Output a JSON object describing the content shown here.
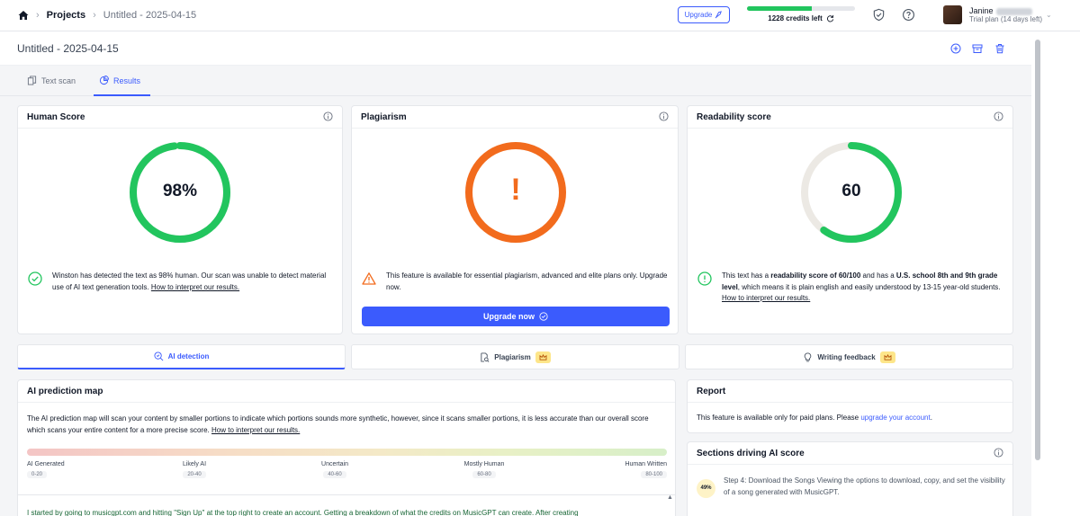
{
  "breadcrumb": {
    "projects": "Projects",
    "document": "Untitled - 2025-04-15"
  },
  "topbar": {
    "upgrade_label": "Upgrade",
    "credits_label": "1228 credits left",
    "credits_fraction": 0.6
  },
  "user": {
    "name": "Janine",
    "plan": "Trial plan (14 days left)"
  },
  "document": {
    "title": "Untitled - 2025-04-15"
  },
  "tabs": [
    {
      "label": "Text scan",
      "active": false
    },
    {
      "label": "Results",
      "active": true
    }
  ],
  "human_score": {
    "title": "Human Score",
    "value": "98%",
    "percent": 98,
    "note_pre": "Winston has detected the text as 98% human. Our scan was unable to detect material use of AI text generation tools.",
    "note_link": "How to interpret our results."
  },
  "plagiarism": {
    "title": "Plagiarism",
    "symbol": "!",
    "note": "This feature is available for essential plagiarism, advanced and elite plans only. Upgrade now.",
    "button": "Upgrade now"
  },
  "readability": {
    "title": "Readability score",
    "value": "60",
    "percent": 60,
    "note_a": "This text has a ",
    "note_b": "readability score of 60/100",
    "note_c": " and has a ",
    "note_d": "U.S. school 8th and 9th grade level",
    "note_e": ", which means it is plain english and easily understood by 13-15 year-old students. ",
    "note_link": "How to interpret our results."
  },
  "feature_tabs": [
    {
      "label": "AI detection",
      "active": true
    },
    {
      "label": "Plagiarism",
      "active": false
    },
    {
      "label": "Writing feedback",
      "active": false
    }
  ],
  "prediction_map": {
    "title": "AI prediction map",
    "description": "The AI prediction map will scan your content by smaller portions to indicate which portions sounds more synthetic, however, since it scans smaller portions, it is less accurate than our overall score which scans your entire content for a more precise score.",
    "link": "How to interpret our results.",
    "scale": [
      {
        "label": "AI Generated",
        "range": "0-20"
      },
      {
        "label": "Likely AI",
        "range": "20-40"
      },
      {
        "label": "Uncertain",
        "range": "40-60"
      },
      {
        "label": "Mostly Human",
        "range": "60-80"
      },
      {
        "label": "Human Written",
        "range": "80-100"
      }
    ],
    "sample_text": "I started by going to musicgpt.com and hitting \"Sign Up\" at the top right to create an account. Getting a breakdown of what the credits on MusicGPT can create. After creating"
  },
  "report": {
    "title": "Report",
    "text": "This feature is available only for paid plans. Please ",
    "link": "upgrade your account",
    "end": "."
  },
  "sections": {
    "title": "Sections driving AI score",
    "items": [
      {
        "percent": "49%",
        "text": "Step 4: Download the Songs Viewing the options to download, copy, and set the visibility of a song generated with MusicGPT."
      }
    ]
  },
  "colors": {
    "accent": "#3b5bfd",
    "green": "#22c55e",
    "orange": "#f26b1d",
    "track": "#ece9e4"
  }
}
